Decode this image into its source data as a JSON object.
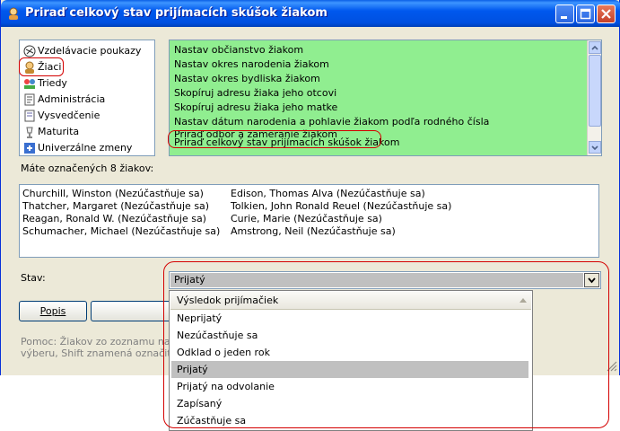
{
  "window": {
    "title": "Priraď celkový stav prijímacích skúšok žiakom"
  },
  "categories": [
    {
      "label": "Vzdelávacie poukazy",
      "icon": "voucher-icon"
    },
    {
      "label": "Žiaci",
      "icon": "students-icon"
    },
    {
      "label": "Triedy",
      "icon": "classes-icon"
    },
    {
      "label": "Administrácia",
      "icon": "administration-icon"
    },
    {
      "label": "Vysvedčenie",
      "icon": "certificate-icon"
    },
    {
      "label": "Maturita",
      "icon": "graduation-icon"
    },
    {
      "label": "Univerzálne zmeny",
      "icon": "universal-changes-icon"
    }
  ],
  "actions": [
    "Nastav občianstvo žiakom",
    "Nastav okres narodenia žiakom",
    "Nastav okres bydliska žiakom",
    "Skopíruj adresu žiaka jeho otcovi",
    "Skopíruj adresu žiaka jeho matke",
    "Nastav dátum narodenia a pohlavie žiakom podľa rodného čísla",
    "Priraď odbor a zameranie žiakom",
    "Priraď celkový stav prijímacích skúšok žiakom"
  ],
  "selected_count_label": "Máte označených 8 žiakov:",
  "students_left": [
    "Churchill, Winston (Nezúčastňuje sa)",
    "Thatcher, Margaret (Nezúčastňuje sa)",
    "Reagan, Ronald W. (Nezúčastňuje sa)",
    "Schumacher, Michael (Nezúčastňuje sa)"
  ],
  "students_right": [
    "Edison, Thomas Alva (Nezúčastňuje sa)",
    "Tolkien, John Ronald Reuel (Nezúčastňuje sa)",
    "Curie, Marie (Nezúčastňuje sa)",
    "Amstrong, Neil (Nezúčastňuje sa)"
  ],
  "stav": {
    "label": "Stav:",
    "value": "Prijatý",
    "list_header": "Výsledok prijímačiek",
    "options": [
      "Neprijatý",
      "Nezúčastňuje sa",
      "Odklad o jeden rok",
      "Prijatý",
      "Prijatý na odvolanie",
      "Zapísaný",
      "Zúčastňuje sa"
    ],
    "selected_option": "Prijatý"
  },
  "buttons": {
    "popis": "Popis"
  },
  "help_text": {
    "line1": "Pomoc: Žiakov zo zoznamu na ha",
    "line2": "výberu, Shift znamená označiť sk"
  },
  "colors": {
    "highlight_red": "#d40000",
    "green_panel": "#90ee90",
    "titlebar": "#0058ee"
  }
}
